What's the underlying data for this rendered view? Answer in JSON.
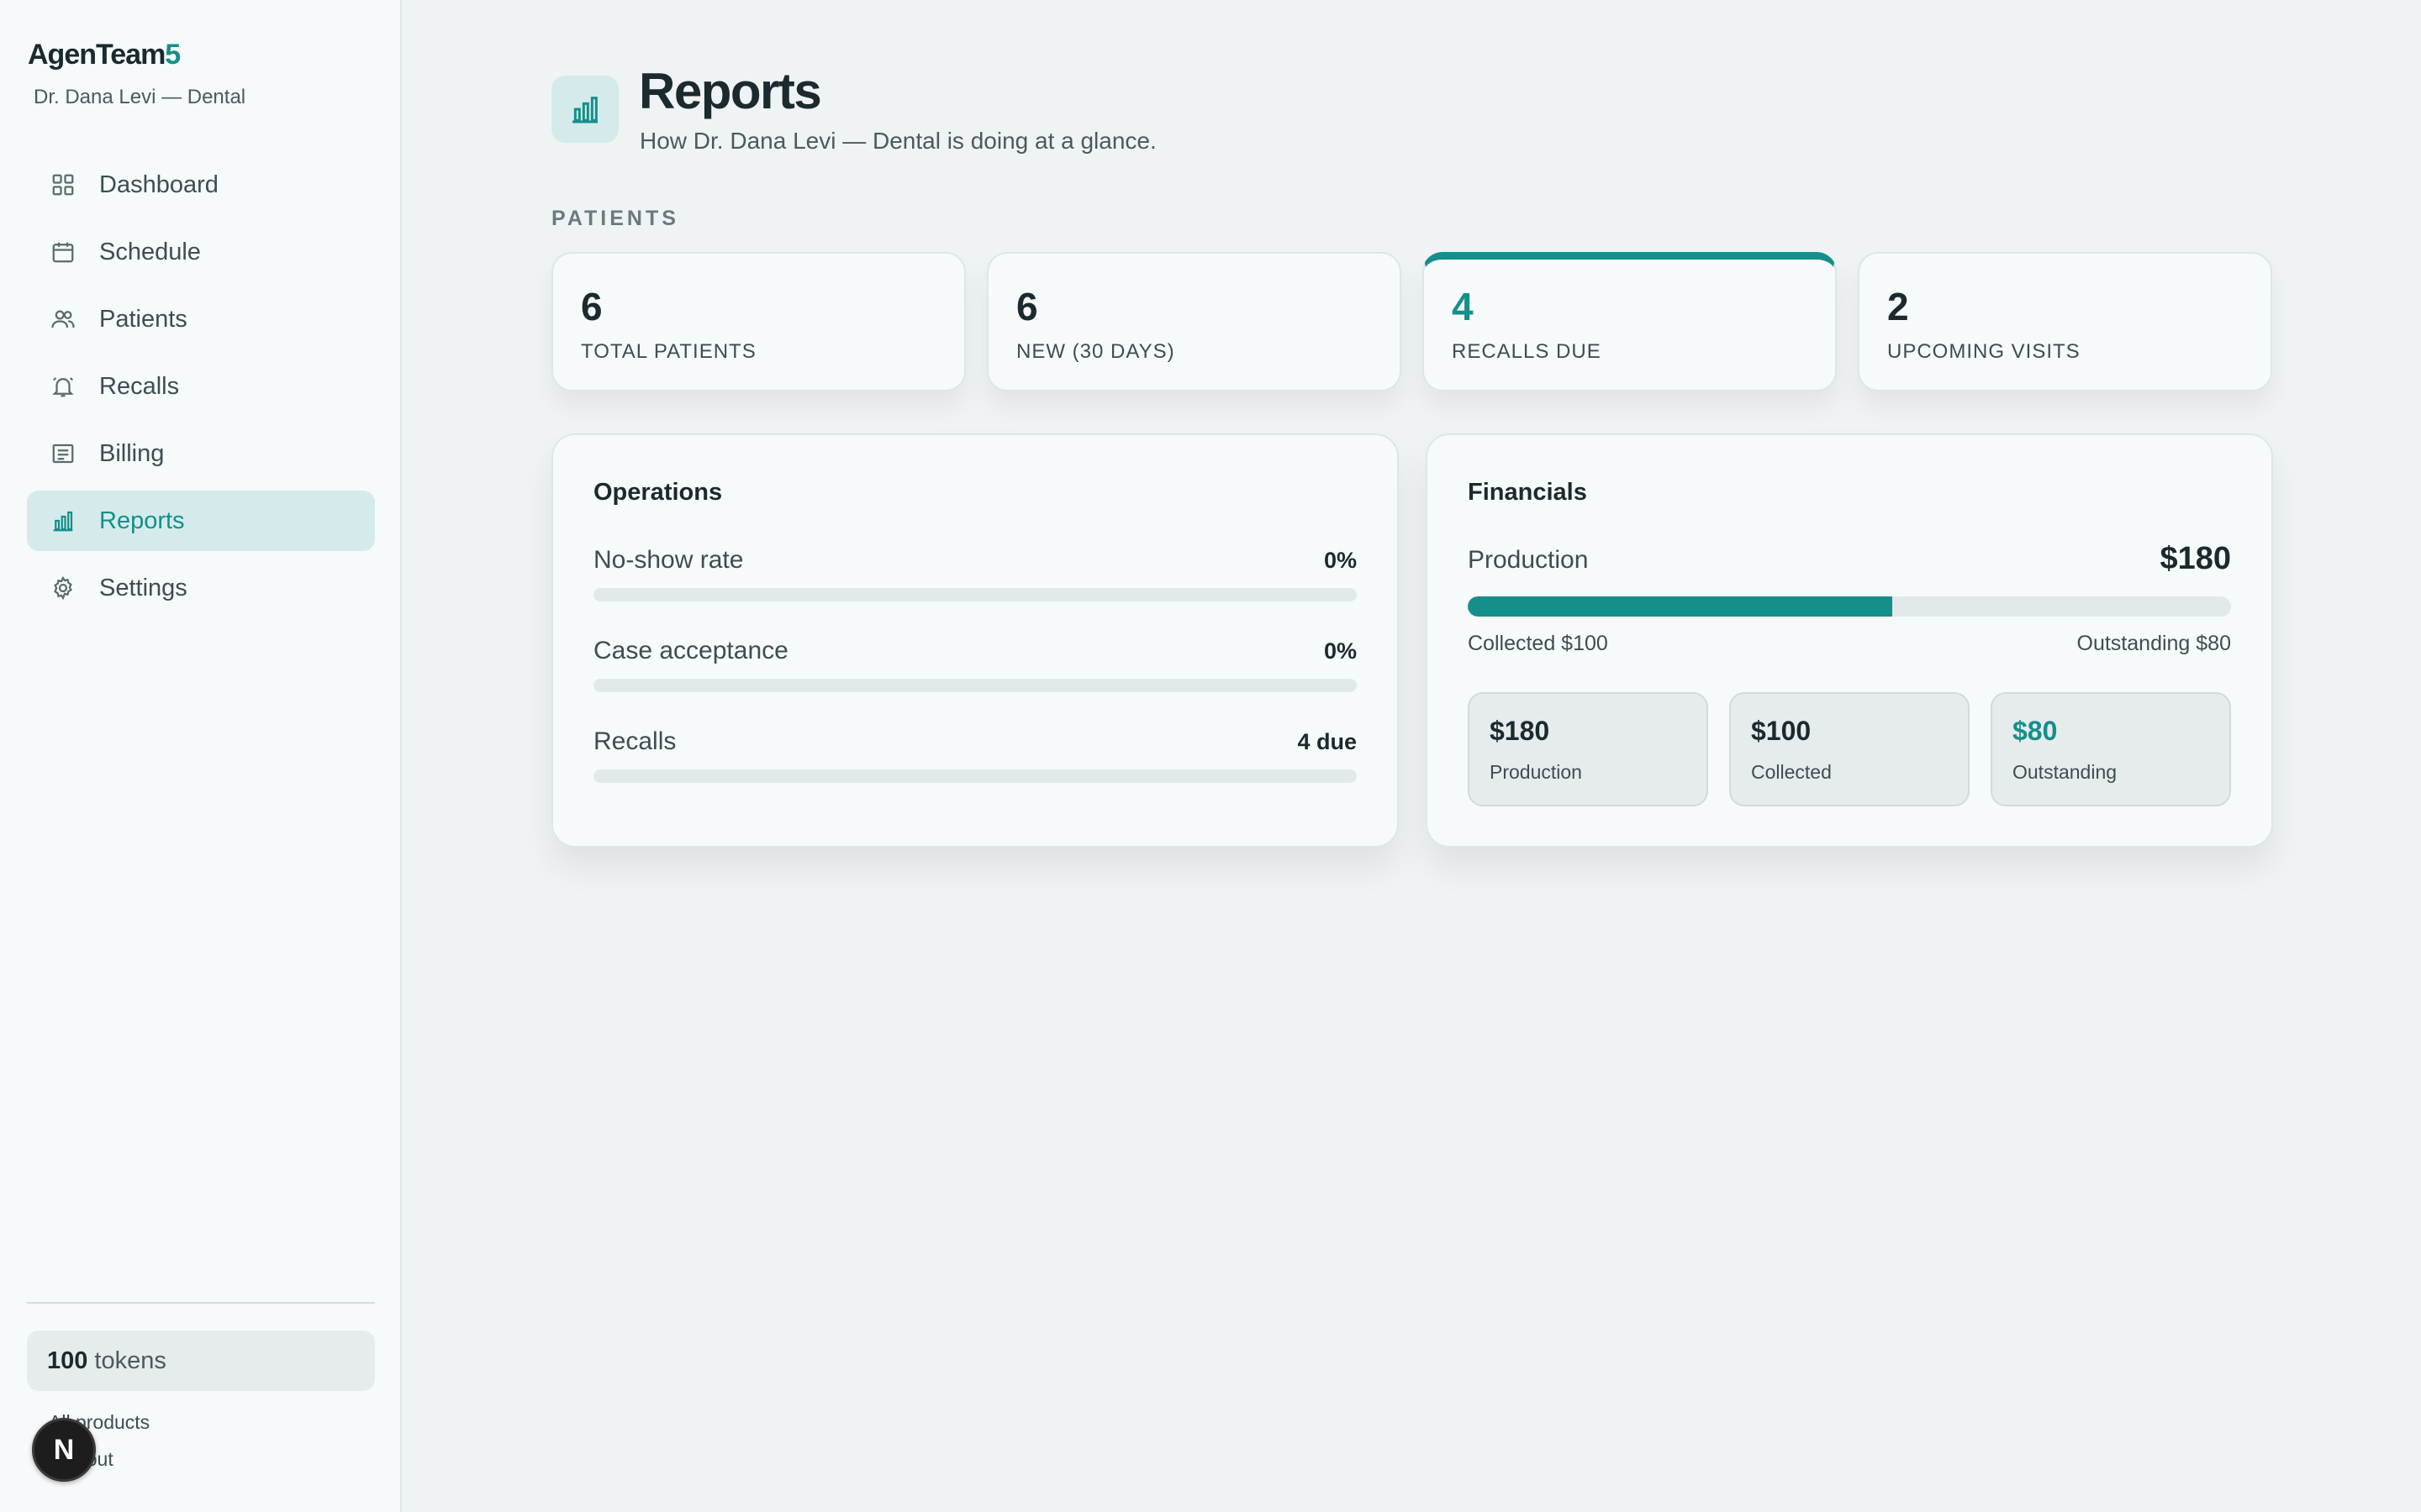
{
  "sidebar": {
    "brand_main": "AgenTeam",
    "brand_accent": "5",
    "subtitle": "Dr. Dana Levi — Dental",
    "items": [
      {
        "label": "Dashboard",
        "icon": "grid-icon",
        "active": false
      },
      {
        "label": "Schedule",
        "icon": "calendar-icon",
        "active": false
      },
      {
        "label": "Patients",
        "icon": "users-icon",
        "active": false
      },
      {
        "label": "Recalls",
        "icon": "bell-icon",
        "active": false
      },
      {
        "label": "Billing",
        "icon": "receipt-icon",
        "active": false
      },
      {
        "label": "Reports",
        "icon": "bar-chart-icon",
        "active": true
      },
      {
        "label": "Settings",
        "icon": "gear-icon",
        "active": false
      }
    ],
    "tokens_count": "100",
    "tokens_label": "tokens",
    "all_products": "All products",
    "logout": "Log out",
    "fab_letter": "N"
  },
  "header": {
    "title": "Reports",
    "subtitle": "How Dr. Dana Levi — Dental is doing at a glance."
  },
  "patients": {
    "section_label": "PATIENTS",
    "stats": [
      {
        "value": "6",
        "label": "TOTAL PATIENTS"
      },
      {
        "value": "6",
        "label": "NEW (30 DAYS)"
      },
      {
        "value": "4",
        "label": "RECALLS DUE"
      },
      {
        "value": "2",
        "label": "UPCOMING VISITS"
      }
    ]
  },
  "operations": {
    "title": "Operations",
    "rows": [
      {
        "name": "No-show rate",
        "value": "0%"
      },
      {
        "name": "Case acceptance",
        "value": "0%"
      },
      {
        "name": "Recalls",
        "value": "4 due"
      }
    ]
  },
  "financials": {
    "title": "Financials",
    "production_label": "Production",
    "production_total": "$180",
    "collected_fraction": 0.556,
    "collected_text": "Collected $100",
    "outstanding_text": "Outstanding $80",
    "cards": [
      {
        "value": "$180",
        "label": "Production"
      },
      {
        "value": "$100",
        "label": "Collected"
      },
      {
        "value": "$80",
        "label": "Outstanding"
      }
    ]
  },
  "colors": {
    "accent": "#158f8a",
    "active_bg": "#d5ebeb",
    "page_bg": "#eff3f4"
  }
}
